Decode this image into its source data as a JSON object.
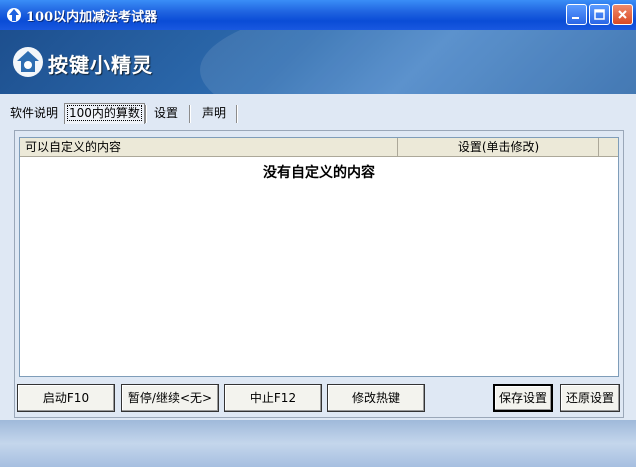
{
  "window": {
    "title": "100以内加减法考试器"
  },
  "banner": {
    "logo_text": "按键小精灵"
  },
  "tabs": [
    {
      "label": "软件说明"
    },
    {
      "label": "100内的算数"
    },
    {
      "label": "设置"
    },
    {
      "label": "声明"
    }
  ],
  "list": {
    "columns": [
      "可以自定义的内容",
      "设置(单击修改)"
    ],
    "empty_message": "没有自定义的内容"
  },
  "buttons": {
    "start": "启动F10",
    "pause": "暂停/继续<无>",
    "stop": "中止F12",
    "hotkey": "修改热键",
    "save": "保存设置",
    "restore": "还原设置"
  },
  "colors": {
    "titlebar": "#0a4cd6",
    "banner": "#2e6db1",
    "panel": "#dfe8f4"
  }
}
